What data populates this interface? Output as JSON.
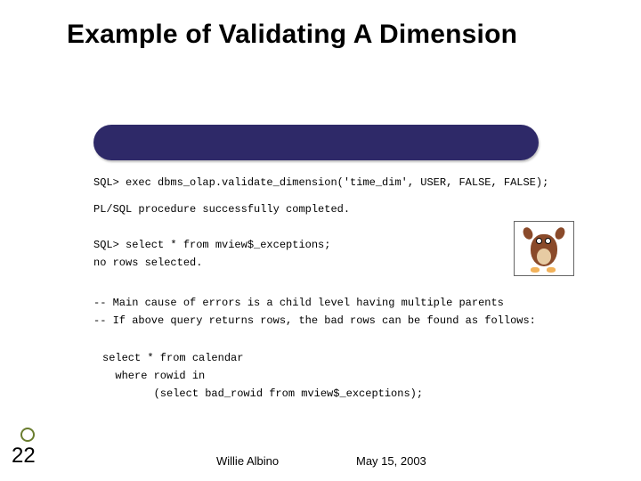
{
  "title": "Example of Validating A Dimension",
  "code": {
    "line1": "SQL> exec dbms_olap.validate_dimension('time_dim', USER, FALSE, FALSE);",
    "line2": "PL/SQL procedure successfully completed.",
    "line3": "SQL> select * from mview$_exceptions;\nno rows selected.",
    "line4": "-- Main cause of errors is a child level having multiple parents\n-- If above query returns rows, the bad rows can be found as follows:",
    "line5": "select * from calendar\n  where rowid in\n        (select bad_rowid from mview$_exceptions);"
  },
  "footer": {
    "slide_number": "22",
    "author": "Willie Albino",
    "date": "May 15, 2003"
  },
  "image": {
    "name": "cartoon-taz-icon"
  }
}
